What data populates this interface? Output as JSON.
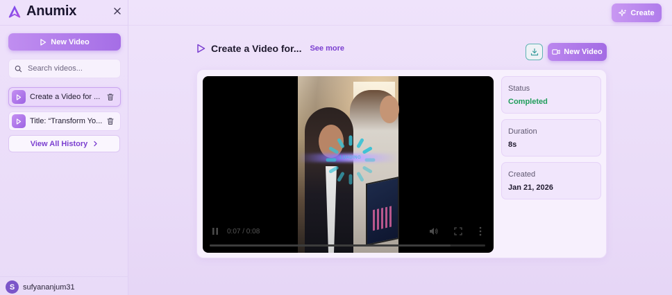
{
  "app": {
    "brand": "Anumix"
  },
  "sidebar": {
    "new_video_label": "New Video",
    "search_placeholder": "Search videos...",
    "history": [
      {
        "label": "Create a Video for ..."
      },
      {
        "label": "Title: “Transform Yo..."
      }
    ],
    "view_all_label": "View All History",
    "user": {
      "initial": "S",
      "name": "sufyananjum31"
    }
  },
  "topbar": {
    "create_label": "Create"
  },
  "page": {
    "title": "Create a Video for...",
    "see_more": "See more",
    "new_video_label": "New Video"
  },
  "player": {
    "loading_text": "LOADING",
    "time": "0:07 / 0:08",
    "progress_fraction": 0.875
  },
  "details": {
    "status_label": "Status",
    "status_value": "Completed",
    "duration_label": "Duration",
    "duration_value": "8s",
    "created_label": "Created",
    "created_value": "Jan 21, 2026"
  },
  "colors": {
    "accent": "#a56ee6",
    "link": "#7b3fd0",
    "success": "#1f9d5a",
    "spinner": "#38c2d6"
  },
  "icons": [
    "logo-icon",
    "close-icon",
    "play-icon",
    "search-icon",
    "trash-icon",
    "chevron-right-icon",
    "sparkle-icon",
    "download-icon",
    "video-camera-icon",
    "pause-icon",
    "volume-icon",
    "fullscreen-icon",
    "more-vertical-icon",
    "spinner-icon"
  ]
}
